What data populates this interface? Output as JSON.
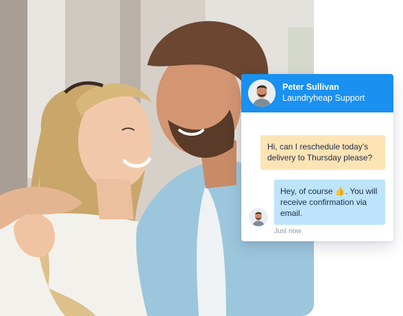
{
  "chat": {
    "agent": {
      "name": "Peter Sullivan",
      "role": "Laundryheap Support"
    },
    "messages": [
      {
        "from": "customer",
        "text": "Hi, can I reschedule today’s delivery to Thursday please?"
      },
      {
        "from": "agent",
        "text": "Hey, of course 👍. You will receive confirmation via email."
      }
    ],
    "status": "Just now"
  },
  "colors": {
    "header": "#1a90f0",
    "customer_bubble": "#fde4b5",
    "agent_bubble": "#bde4fb"
  }
}
